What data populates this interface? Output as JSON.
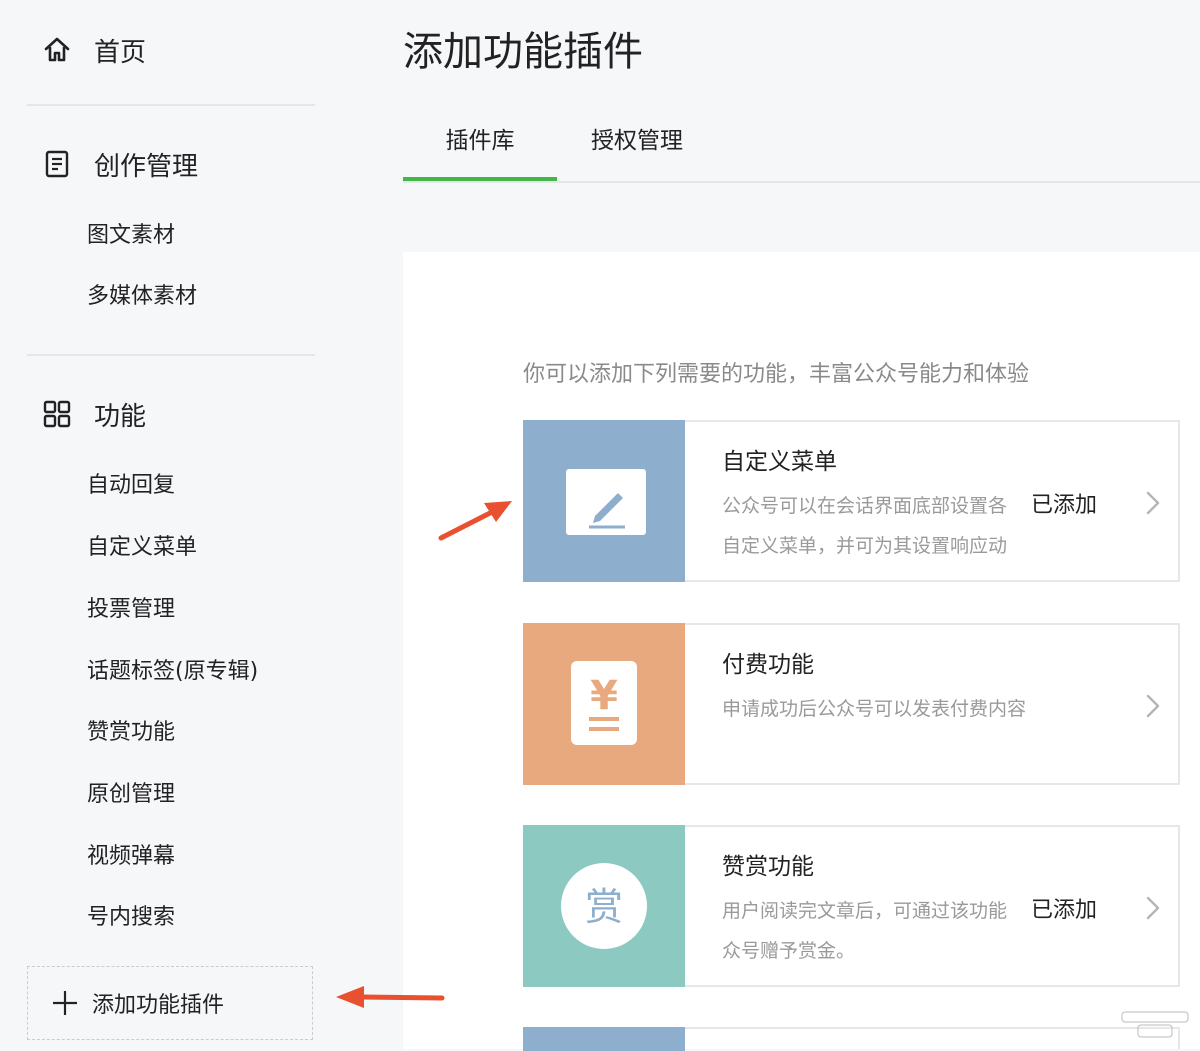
{
  "sidebar": {
    "home": {
      "label": "首页",
      "icon": "home-icon"
    },
    "creation": {
      "label": "创作管理",
      "icon": "document-icon",
      "items": [
        "图文素材",
        "多媒体素材"
      ]
    },
    "features": {
      "label": "功能",
      "icon": "grid-icon",
      "items": [
        "自动回复",
        "自定义菜单",
        "投票管理",
        "话题标签(原专辑)",
        "赞赏功能",
        "原创管理",
        "视频弹幕",
        "号内搜索"
      ]
    },
    "add_plugin": {
      "label": "添加功能插件",
      "icon": "plus-icon"
    }
  },
  "main": {
    "title": "添加功能插件",
    "tabs": [
      {
        "label": "插件库",
        "active": true
      },
      {
        "label": "授权管理",
        "active": false
      }
    ],
    "intro": "你可以添加下列需要的功能，丰富公众号能力和体验",
    "plugins": [
      {
        "name": "自定义菜单",
        "desc_lines": [
          "公众号可以在会话界面底部设置各",
          "自定义菜单，并可为其设置响应动"
        ],
        "status": "已添加",
        "icon": "pencil-icon",
        "color": "#8daecc"
      },
      {
        "name": "付费功能",
        "desc_lines": [
          "申请成功后公众号可以发表付费内容"
        ],
        "status": "",
        "icon": "yuan-icon",
        "icon_glyph": "¥",
        "color": "#e8a97f"
      },
      {
        "name": "赞赏功能",
        "desc_lines": [
          "用户阅读完文章后，可通过该功能",
          "众号赠予赏金。"
        ],
        "status": "已添加",
        "icon": "reward-icon",
        "icon_glyph": "赏",
        "color": "#8bc9c1"
      }
    ]
  },
  "colors": {
    "accent": "#44b549",
    "annotation_arrow": "#e9502f"
  }
}
